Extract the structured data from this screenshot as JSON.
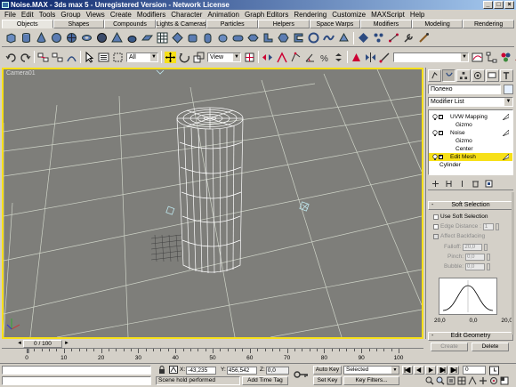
{
  "window": {
    "title": "Noise.MAX - 3ds max 5 - Unregistered Version - Network License"
  },
  "menu": [
    "File",
    "Edit",
    "Tools",
    "Group",
    "Views",
    "Create",
    "Modifiers",
    "Character",
    "Animation",
    "Graph Editors",
    "Rendering",
    "Customize",
    "MAXScript",
    "Help"
  ],
  "tabs": [
    "Objects",
    "Shapes",
    "Compounds",
    "Lights & Cameras",
    "Particles",
    "Helpers",
    "Space Warps",
    "Modifiers",
    "Modeling",
    "Rendering"
  ],
  "active_tab": "Objects",
  "toolbar2": {
    "selection_filter": "All",
    "reference_coord": "View"
  },
  "viewport": {
    "label": "Camera01",
    "border_color": "#f7e018",
    "background": "#7e7e7a"
  },
  "command_panel": {
    "object_name": "Полено",
    "modifier_list": "Modifier List",
    "stack": [
      {
        "label": "UVW Mapping",
        "type": "modifier",
        "expanded": true
      },
      {
        "label": "Gizmo",
        "type": "sub"
      },
      {
        "label": "Noise",
        "type": "modifier",
        "expanded": true
      },
      {
        "label": "Gizmo",
        "type": "sub"
      },
      {
        "label": "Center",
        "type": "sub"
      },
      {
        "label": "Edit Mesh",
        "type": "modifier",
        "selected": true
      },
      {
        "label": "Cylinder",
        "type": "base"
      }
    ],
    "soft_selection": {
      "title": "Soft Selection",
      "use_soft_selection": "Use Soft Selection",
      "edge_distance": "Edge Distance :",
      "edge_distance_value": "1",
      "affect_backfacing": "Affect Backfacing",
      "falloff_label": "Falloff:",
      "falloff_value": "20,0",
      "pinch_label": "Pinch:",
      "pinch_value": "0,0",
      "bubble_label": "Bubble:",
      "bubble_value": "0,0",
      "curve_left": "20,0",
      "curve_mid": "0,0",
      "curve_right": "20,0"
    },
    "edit_geometry": {
      "title": "Edit Geometry",
      "create_label": "Create",
      "delete_label": "Delete"
    }
  },
  "time_slider": {
    "label": "0 / 100"
  },
  "trackbar": {
    "labels": [
      "0",
      "10",
      "20",
      "30",
      "40",
      "50",
      "60",
      "70",
      "80",
      "90",
      "100"
    ]
  },
  "status": {
    "x_label": "X:",
    "x_value": "-43,235",
    "y_label": "Y:",
    "y_value": "456,542",
    "z_label": "Z:",
    "z_value": "0,0",
    "status_text": "Scene hold performed",
    "add_time_tag": "Add Time Tag",
    "auto_key": "Auto Key",
    "set_key": "Set Key",
    "selected": "Selected",
    "key_filters": "Key Filters...",
    "frame": "0"
  }
}
